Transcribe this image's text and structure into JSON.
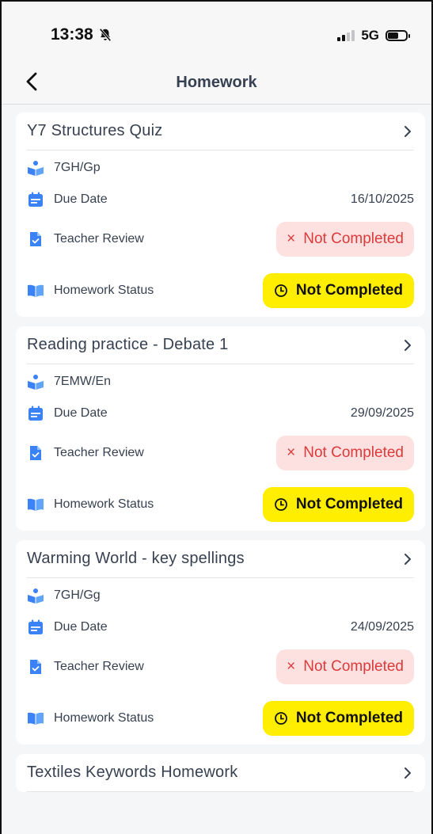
{
  "status_bar": {
    "time": "13:38",
    "network": "5G"
  },
  "header": {
    "title": "Homework"
  },
  "colors": {
    "red_pill_bg": "#fde0e0",
    "red_text": "#dc3b3b",
    "yellow_pill": "#ffee00",
    "icon_blue": "#3b82f6"
  },
  "labels": {
    "due_date": "Due Date",
    "teacher_review": "Teacher Review",
    "homework_status": "Homework Status"
  },
  "homework": [
    {
      "title": "Y7 Structures Quiz",
      "class": "7GH/Gp",
      "due_date": "16/10/2025",
      "teacher_review": "Not Completed",
      "homework_status": "Not Completed"
    },
    {
      "title": "Reading practice - Debate 1",
      "class": "7EMW/En",
      "due_date": "29/09/2025",
      "teacher_review": "Not Completed",
      "homework_status": "Not Completed"
    },
    {
      "title": "Warming World - key spellings",
      "class": "7GH/Gg",
      "due_date": "24/09/2025",
      "teacher_review": "Not Completed",
      "homework_status": "Not Completed"
    },
    {
      "title": "Textiles Keywords Homework"
    }
  ],
  "icons": {
    "class": "reader-icon",
    "due": "calendar-icon",
    "review": "document-check-icon",
    "status": "open-book-icon",
    "review_pill": "x-icon",
    "status_pill": "clock-icon"
  }
}
